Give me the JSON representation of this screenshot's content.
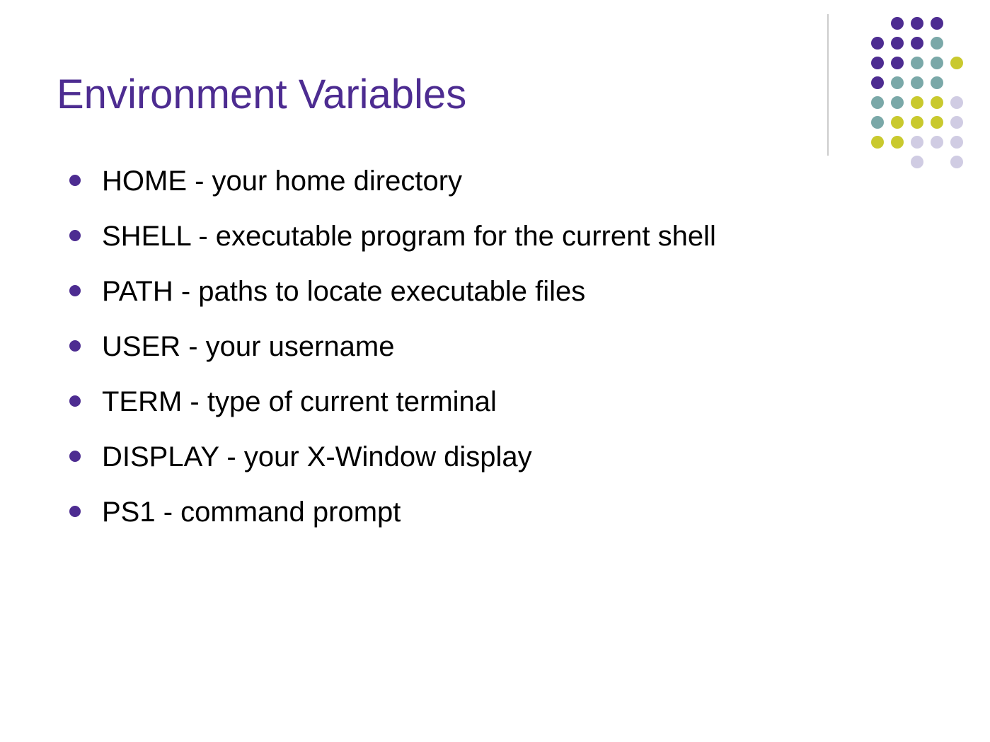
{
  "title": "Environment Variables",
  "bullets": [
    "HOME - your home directory",
    "SHELL - executable program for the current shell",
    "PATH - paths to locate executable files",
    "USER - your username",
    "TERM - type of current terminal",
    "DISPLAY - your X-Window display",
    "PS1 - command prompt"
  ],
  "colors": {
    "title": "#4d2c91",
    "bullet": "#4d2c91",
    "purple": "#4d2c91",
    "teal": "#7aa8a8",
    "yellow": "#c9c92e",
    "lavender": "#d0cce3"
  }
}
